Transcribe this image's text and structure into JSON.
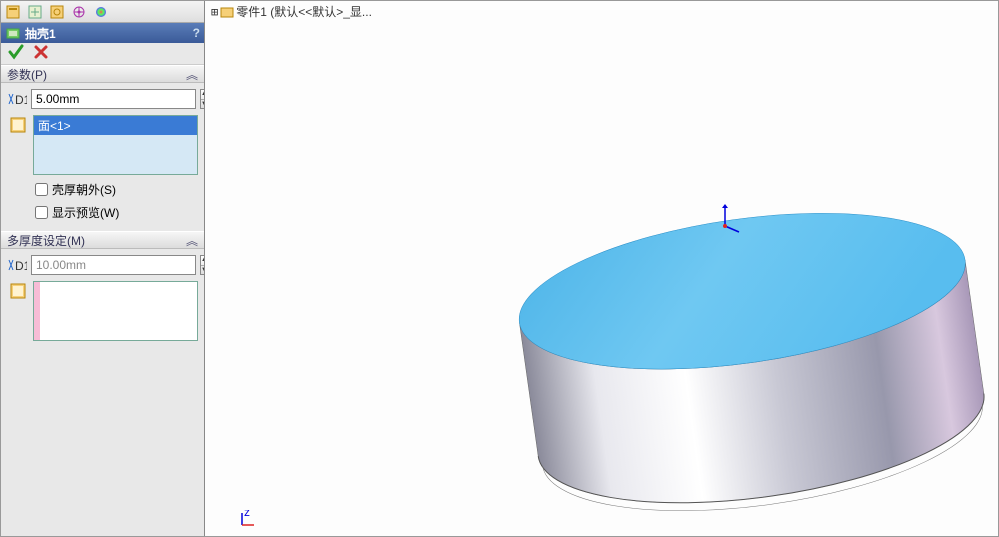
{
  "toolbar": {
    "icons": [
      "features-icon",
      "props-icon",
      "config-icon",
      "dimxpert-icon",
      "appearance-icon"
    ]
  },
  "feature": {
    "icon": "shell-icon",
    "title": "抽壳1",
    "help": "?"
  },
  "groups": {
    "params": {
      "label": "参数(P)",
      "d1_icon": "D1",
      "d1_value": "5.00mm",
      "face_list": {
        "items": [
          "面<1>"
        ]
      },
      "shell_outward": {
        "label": "壳厚朝外(S)",
        "checked": false
      },
      "show_preview": {
        "label": "显示预览(W)",
        "checked": false
      }
    },
    "multi": {
      "label": "多厚度设定(M)",
      "d1_icon": "D1",
      "d1_value": "10.00mm",
      "face_list": {
        "items": []
      }
    }
  },
  "tree": {
    "root": "零件1  (默认<<默认>_显..."
  },
  "colors": {
    "top_face": "#5fc0ef",
    "side_light": "#f2f2f6",
    "side_dark": "#9a9ab0"
  }
}
